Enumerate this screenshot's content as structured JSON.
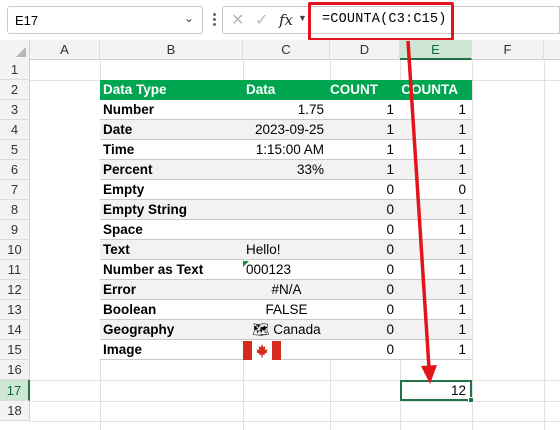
{
  "formula_bar": {
    "name_box": "E17",
    "name_box_dropdown_icon": "chevron-down-icon",
    "cancel_icon": "✕",
    "enter_icon": "✓",
    "fx_label": "fx",
    "formula": "=COUNTA(C3:C15)"
  },
  "columns": [
    "A",
    "B",
    "C",
    "D",
    "E",
    "F"
  ],
  "selected_column": "E",
  "rows": [
    "1",
    "2",
    "3",
    "4",
    "5",
    "6",
    "7",
    "8",
    "9",
    "10",
    "11",
    "12",
    "13",
    "14",
    "15",
    "16",
    "17",
    "18"
  ],
  "selected_row": "17",
  "table": {
    "headers": [
      "Data Type",
      "Data",
      "COUNT",
      "COUNTA"
    ],
    "rows": [
      {
        "type": "Number",
        "data": "1.75",
        "count": "1",
        "counta": "1"
      },
      {
        "type": "Date",
        "data": "2023-09-25",
        "count": "1",
        "counta": "1"
      },
      {
        "type": "Time",
        "data": "1:15:00 AM",
        "count": "1",
        "counta": "1"
      },
      {
        "type": "Percent",
        "data": "33%",
        "count": "1",
        "counta": "1"
      },
      {
        "type": "Empty",
        "data": "",
        "count": "0",
        "counta": "0"
      },
      {
        "type": "Empty String",
        "data": "",
        "count": "0",
        "counta": "1"
      },
      {
        "type": "Space",
        "data": "",
        "count": "0",
        "counta": "1"
      },
      {
        "type": "Text",
        "data": "Hello!",
        "count": "0",
        "counta": "1"
      },
      {
        "type": "Number as Text",
        "data": "000123",
        "count": "0",
        "counta": "1"
      },
      {
        "type": "Error",
        "data": "#N/A",
        "count": "0",
        "counta": "1"
      },
      {
        "type": "Boolean",
        "data": "FALSE",
        "count": "0",
        "counta": "1"
      },
      {
        "type": "Geography",
        "data": "🗺 Canada",
        "count": "0",
        "counta": "1"
      },
      {
        "type": "Image",
        "data": "",
        "count": "0",
        "counta": "1"
      }
    ]
  },
  "result": {
    "cell": "E17",
    "value": "12"
  },
  "colors": {
    "header_green": "#00a550",
    "selection_green": "#217346",
    "annotation_red": "#e3141b"
  }
}
